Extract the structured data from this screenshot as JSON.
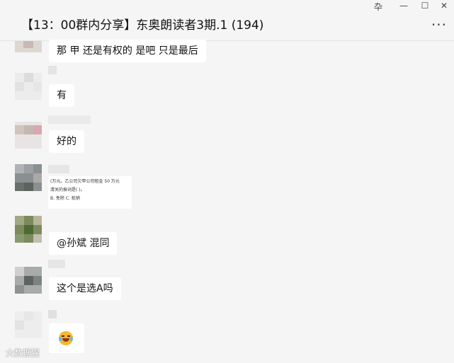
{
  "window": {
    "title": "【13：00群内分享】东奥朗读者3期.1 (194)",
    "controls": [
      "卆",
      "—",
      "☐",
      "✕"
    ],
    "more_label": "..."
  },
  "messages": [
    {
      "type": "text",
      "text": "那 甲 还是有权的 是吧  只是最后"
    },
    {
      "type": "text",
      "text": "有"
    },
    {
      "type": "text",
      "text": "好的"
    },
    {
      "type": "image",
      "lines": [
        "(万元。乙公司欠甲公司租金 50 万元",
        "清关的振词是(   )。",
        "B. 免除              C. 抵销"
      ]
    },
    {
      "type": "text",
      "text": "@孙斌 混同"
    },
    {
      "type": "text",
      "text": "这个是选A吗"
    },
    {
      "type": "emoji",
      "icon": "laughing-crying-emoji-icon"
    }
  ],
  "watermark": "大数据猩"
}
